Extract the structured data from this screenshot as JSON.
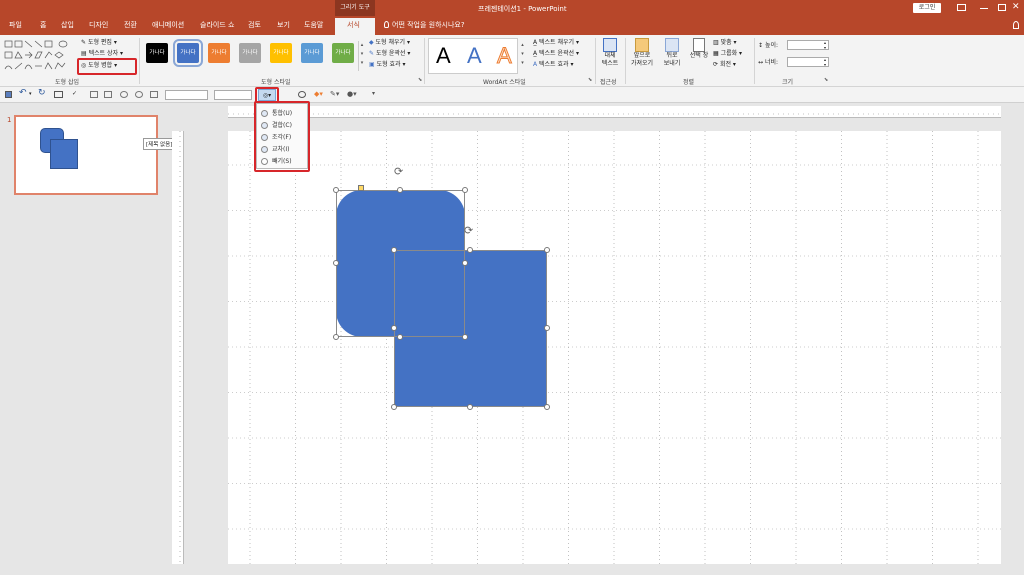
{
  "titlebar": {
    "context_tab": "그리기 도구",
    "title": "프레젠테이션1 - PowerPoint",
    "login": "로그인"
  },
  "tabs": [
    "파일",
    "홈",
    "삽입",
    "디자인",
    "전환",
    "애니메이션",
    "슬라이드 쇼",
    "검토",
    "보기",
    "도움말",
    "서식"
  ],
  "tell_me": "어떤 작업을 원하시나요?",
  "ribbon": {
    "insert_shapes": {
      "edit_shape": "도형 편집",
      "text_box": "텍스트 상자",
      "merge_shapes": "도형 병합",
      "group_label": "도형 삽입"
    },
    "shape_styles": {
      "tile_text": "가나다",
      "tiles": [
        {
          "color": "#000000",
          "selected": false
        },
        {
          "color": "#4472c4",
          "selected": true
        },
        {
          "color": "#ed7d31",
          "selected": false
        },
        {
          "color": "#a5a5a5",
          "selected": false
        },
        {
          "color": "#ffc000",
          "selected": false
        },
        {
          "color": "#5b9bd5",
          "selected": false
        },
        {
          "color": "#70ad47",
          "selected": false
        }
      ],
      "fill": "도형 채우기",
      "outline": "도형 윤곽선",
      "effects": "도형 효과",
      "group_label": "도형 스타일"
    },
    "wordart": {
      "letter": "A",
      "text_fill": "텍스트 채우기",
      "text_outline": "텍스트 윤곽선",
      "text_effects": "텍스트 효과",
      "group_label": "WordArt 스타일"
    },
    "accessibility": {
      "alt_text_line1": "대체",
      "alt_text_line2": "텍스트",
      "group_label": "접근성"
    },
    "arrange": {
      "bring_forward_line1": "앞으로",
      "bring_forward_line2": "가져오기",
      "send_backward_line1": "뒤로",
      "send_backward_line2": "보내기",
      "selection_pane_line1": "선택",
      "selection_pane_line2": "창",
      "align": "맞춤",
      "group": "그룹화",
      "rotate": "회전",
      "group_label": "정렬"
    },
    "size": {
      "height_label": "높이:",
      "width_label": "너비:",
      "group_label": "크기"
    }
  },
  "merge_menu": {
    "items": [
      {
        "label": "통합(U)"
      },
      {
        "label": "결합(C)"
      },
      {
        "label": "조각(F)"
      },
      {
        "label": "교차(I)"
      },
      {
        "label": "빼기(S)"
      }
    ]
  },
  "thumbnail": {
    "number": "1",
    "tooltip": "[제목 없음]"
  },
  "colors": {
    "accent": "#b7472a",
    "shape_fill": "#4472c4",
    "highlight": "#d7262a"
  }
}
